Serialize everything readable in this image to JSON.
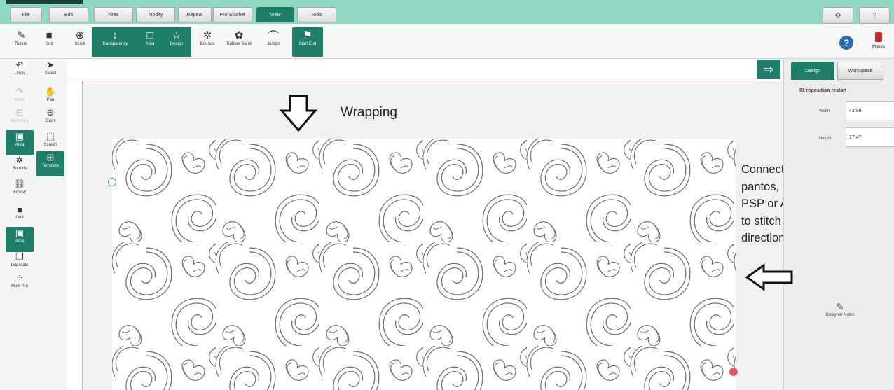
{
  "menu": {
    "tabs": [
      {
        "label": "File"
      },
      {
        "label": "Edit"
      },
      {
        "label": "Area"
      },
      {
        "label": "Modify"
      },
      {
        "label": "Repeat"
      },
      {
        "label": "Pro-Stitcher"
      },
      {
        "label": "View"
      },
      {
        "label": "Tools"
      }
    ],
    "active": "View",
    "right_buttons": [
      {
        "label": "⚙",
        "icon": "gear-icon"
      },
      {
        "label": "?",
        "icon": "question-icon"
      }
    ]
  },
  "toolbar": {
    "tools": [
      {
        "label": "Rulers",
        "icon": "ruler-icon",
        "glyph": "✎"
      },
      {
        "label": "Grid",
        "icon": "grid-icon",
        "glyph": "■"
      },
      {
        "label": "Scroll",
        "icon": "scroll-icon",
        "glyph": "⊕"
      },
      {
        "label": "Transparency",
        "icon": "transparency-icon",
        "glyph": "↕"
      },
      {
        "label": "Area",
        "icon": "area-icon",
        "glyph": "□"
      },
      {
        "label": "Design",
        "icon": "design-star-icon",
        "glyph": "☆"
      },
      {
        "label": "Bounds",
        "icon": "bounds-icon",
        "glyph": "✲"
      },
      {
        "label": "Rubber Band",
        "icon": "rubber-band-icon",
        "glyph": "✿"
      },
      {
        "label": "Jumps",
        "icon": "jumps-icon",
        "glyph": "⌒"
      },
      {
        "label": "Start End",
        "icon": "start-end-icon",
        "glyph": "⚑"
      }
    ],
    "motor_label": "Motors"
  },
  "left_tools": [
    {
      "label": "Undo",
      "icon": "undo-icon",
      "glyph": "↶"
    },
    {
      "label": "Select",
      "icon": "select-pointer-icon",
      "glyph": "➤"
    },
    {
      "label": "Redo",
      "icon": "redo-icon",
      "glyph": "↷"
    },
    {
      "label": "Pan",
      "icon": "pan-hand-icon",
      "glyph": "✋"
    },
    {
      "label": "Boundary",
      "icon": "boundary-icon",
      "glyph": "⊟"
    },
    {
      "label": "Zoom",
      "icon": "zoom-icon",
      "glyph": "⊕"
    },
    {
      "label": "Area",
      "icon": "area-icon",
      "glyph": "▣"
    },
    {
      "label": "Screen",
      "icon": "screen-icon",
      "glyph": "⬚"
    },
    {
      "label": "Bounds",
      "icon": "bounds-star-icon",
      "glyph": "✲"
    },
    {
      "label": "Template",
      "icon": "template-icon",
      "glyph": "⊞"
    },
    {
      "label": "Follow",
      "icon": "follow-icon",
      "glyph": "⛓"
    },
    {
      "label": "Grid",
      "icon": "grid-icon",
      "glyph": "■"
    },
    {
      "label": "Area",
      "icon": "area-icon",
      "glyph": "▣"
    },
    {
      "label": "Duplicate",
      "icon": "duplicate-icon",
      "glyph": "❐"
    },
    {
      "label": "Multi Pro",
      "icon": "multi-pro-icon",
      "glyph": "⁘"
    }
  ],
  "canvas": {
    "wrapping_label": "Wrapping",
    "next_button": "⇨"
  },
  "annotation": {
    "lines": [
      "Connected, end to end,",
      "pantos, done with both",
      "PSP or ANS, allowing you",
      "to stitch in both",
      "directions."
    ]
  },
  "right_panel": {
    "tabs": [
      {
        "label": "Design"
      },
      {
        "label": "Workspace"
      }
    ],
    "design_name": "01 reposition restart",
    "width_label": "Width",
    "width_value": "43.88",
    "height_label": "Height",
    "height_value": "17.47",
    "designer_notes_label": "Designer Notes"
  },
  "colors": {
    "accent": "#1f7e6a",
    "menu_bg": "#8ed8c4",
    "start_marker": "#3aa85a",
    "stop_marker": "#e05a5a"
  }
}
